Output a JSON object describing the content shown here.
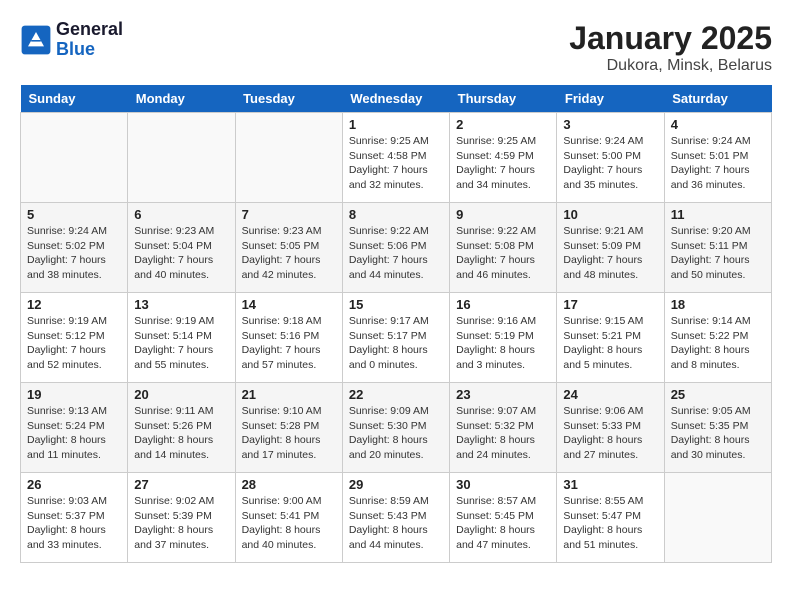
{
  "header": {
    "logo_line1": "General",
    "logo_line2": "Blue",
    "title": "January 2025",
    "location": "Dukora, Minsk, Belarus"
  },
  "weekdays": [
    "Sunday",
    "Monday",
    "Tuesday",
    "Wednesday",
    "Thursday",
    "Friday",
    "Saturday"
  ],
  "weeks": [
    [
      {
        "day": "",
        "info": ""
      },
      {
        "day": "",
        "info": ""
      },
      {
        "day": "",
        "info": ""
      },
      {
        "day": "1",
        "info": "Sunrise: 9:25 AM\nSunset: 4:58 PM\nDaylight: 7 hours\nand 32 minutes."
      },
      {
        "day": "2",
        "info": "Sunrise: 9:25 AM\nSunset: 4:59 PM\nDaylight: 7 hours\nand 34 minutes."
      },
      {
        "day": "3",
        "info": "Sunrise: 9:24 AM\nSunset: 5:00 PM\nDaylight: 7 hours\nand 35 minutes."
      },
      {
        "day": "4",
        "info": "Sunrise: 9:24 AM\nSunset: 5:01 PM\nDaylight: 7 hours\nand 36 minutes."
      }
    ],
    [
      {
        "day": "5",
        "info": "Sunrise: 9:24 AM\nSunset: 5:02 PM\nDaylight: 7 hours\nand 38 minutes."
      },
      {
        "day": "6",
        "info": "Sunrise: 9:23 AM\nSunset: 5:04 PM\nDaylight: 7 hours\nand 40 minutes."
      },
      {
        "day": "7",
        "info": "Sunrise: 9:23 AM\nSunset: 5:05 PM\nDaylight: 7 hours\nand 42 minutes."
      },
      {
        "day": "8",
        "info": "Sunrise: 9:22 AM\nSunset: 5:06 PM\nDaylight: 7 hours\nand 44 minutes."
      },
      {
        "day": "9",
        "info": "Sunrise: 9:22 AM\nSunset: 5:08 PM\nDaylight: 7 hours\nand 46 minutes."
      },
      {
        "day": "10",
        "info": "Sunrise: 9:21 AM\nSunset: 5:09 PM\nDaylight: 7 hours\nand 48 minutes."
      },
      {
        "day": "11",
        "info": "Sunrise: 9:20 AM\nSunset: 5:11 PM\nDaylight: 7 hours\nand 50 minutes."
      }
    ],
    [
      {
        "day": "12",
        "info": "Sunrise: 9:19 AM\nSunset: 5:12 PM\nDaylight: 7 hours\nand 52 minutes."
      },
      {
        "day": "13",
        "info": "Sunrise: 9:19 AM\nSunset: 5:14 PM\nDaylight: 7 hours\nand 55 minutes."
      },
      {
        "day": "14",
        "info": "Sunrise: 9:18 AM\nSunset: 5:16 PM\nDaylight: 7 hours\nand 57 minutes."
      },
      {
        "day": "15",
        "info": "Sunrise: 9:17 AM\nSunset: 5:17 PM\nDaylight: 8 hours\nand 0 minutes."
      },
      {
        "day": "16",
        "info": "Sunrise: 9:16 AM\nSunset: 5:19 PM\nDaylight: 8 hours\nand 3 minutes."
      },
      {
        "day": "17",
        "info": "Sunrise: 9:15 AM\nSunset: 5:21 PM\nDaylight: 8 hours\nand 5 minutes."
      },
      {
        "day": "18",
        "info": "Sunrise: 9:14 AM\nSunset: 5:22 PM\nDaylight: 8 hours\nand 8 minutes."
      }
    ],
    [
      {
        "day": "19",
        "info": "Sunrise: 9:13 AM\nSunset: 5:24 PM\nDaylight: 8 hours\nand 11 minutes."
      },
      {
        "day": "20",
        "info": "Sunrise: 9:11 AM\nSunset: 5:26 PM\nDaylight: 8 hours\nand 14 minutes."
      },
      {
        "day": "21",
        "info": "Sunrise: 9:10 AM\nSunset: 5:28 PM\nDaylight: 8 hours\nand 17 minutes."
      },
      {
        "day": "22",
        "info": "Sunrise: 9:09 AM\nSunset: 5:30 PM\nDaylight: 8 hours\nand 20 minutes."
      },
      {
        "day": "23",
        "info": "Sunrise: 9:07 AM\nSunset: 5:32 PM\nDaylight: 8 hours\nand 24 minutes."
      },
      {
        "day": "24",
        "info": "Sunrise: 9:06 AM\nSunset: 5:33 PM\nDaylight: 8 hours\nand 27 minutes."
      },
      {
        "day": "25",
        "info": "Sunrise: 9:05 AM\nSunset: 5:35 PM\nDaylight: 8 hours\nand 30 minutes."
      }
    ],
    [
      {
        "day": "26",
        "info": "Sunrise: 9:03 AM\nSunset: 5:37 PM\nDaylight: 8 hours\nand 33 minutes."
      },
      {
        "day": "27",
        "info": "Sunrise: 9:02 AM\nSunset: 5:39 PM\nDaylight: 8 hours\nand 37 minutes."
      },
      {
        "day": "28",
        "info": "Sunrise: 9:00 AM\nSunset: 5:41 PM\nDaylight: 8 hours\nand 40 minutes."
      },
      {
        "day": "29",
        "info": "Sunrise: 8:59 AM\nSunset: 5:43 PM\nDaylight: 8 hours\nand 44 minutes."
      },
      {
        "day": "30",
        "info": "Sunrise: 8:57 AM\nSunset: 5:45 PM\nDaylight: 8 hours\nand 47 minutes."
      },
      {
        "day": "31",
        "info": "Sunrise: 8:55 AM\nSunset: 5:47 PM\nDaylight: 8 hours\nand 51 minutes."
      },
      {
        "day": "",
        "info": ""
      }
    ]
  ]
}
